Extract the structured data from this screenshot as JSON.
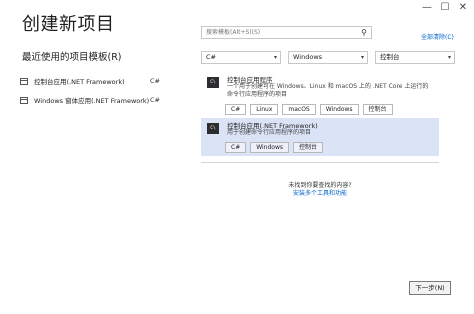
{
  "window": {
    "minimize_glyph": "—",
    "maximize_glyph": "☐",
    "close_glyph": "✕"
  },
  "page_title": "创建新项目",
  "recent": {
    "title": "最近使用的项目模板(R)",
    "items": [
      {
        "label": "控制台应用(.NET Framework)",
        "lang": "C#",
        "icon": "console-app-icon"
      },
      {
        "label": "Windows 窗体应用(.NET Framework)",
        "lang": "C#",
        "icon": "windows-forms-icon"
      }
    ]
  },
  "search": {
    "placeholder": "搜索模板(Alt+S)(S)",
    "icon": "search-icon"
  },
  "clear_all": "全部清除(C)",
  "filters": {
    "language": "C#",
    "platform": "Windows",
    "project_type": "控制台"
  },
  "templates": [
    {
      "title": "控制台应用程序",
      "description": "一个用于创建可在 Windows、Linux 和 macOS 上的 .NET Core 上运行的命令行应用程序的项目",
      "icon_text": "C\\",
      "tags": [
        "C#",
        "Linux",
        "macOS",
        "Windows",
        "控制台"
      ],
      "selected": false
    },
    {
      "title": "控制台应用(.NET Framework)",
      "description": "用于创建命令行应用程序的项目",
      "icon_text": "C\\",
      "tags": [
        "C#",
        "Windows",
        "控制台"
      ],
      "selected": true
    }
  ],
  "not_found": {
    "question": "未找到你要查找的内容?",
    "link": "安装多个工具和功能"
  },
  "next_button": "下一步(N)",
  "colors": {
    "accent_link": "#0066cc",
    "selected_card": "#dbe3f7",
    "icon_bg": "#2d2d30"
  }
}
